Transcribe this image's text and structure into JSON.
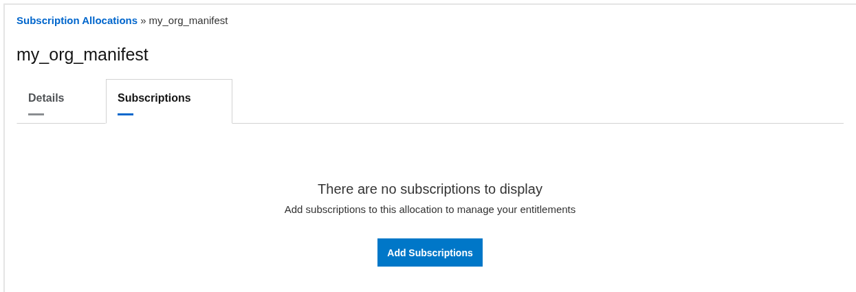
{
  "breadcrumb": {
    "link": "Subscription Allocations",
    "separator": "»",
    "current": "my_org_manifest"
  },
  "title": "my_org_manifest",
  "tabs": [
    {
      "label": "Details",
      "selected": false
    },
    {
      "label": "Subscriptions",
      "selected": true
    }
  ],
  "empty_state": {
    "heading": "There are no subscriptions to display",
    "message": "Add subscriptions to this allocation to manage your entitlements",
    "button": "Add Subscriptions"
  }
}
